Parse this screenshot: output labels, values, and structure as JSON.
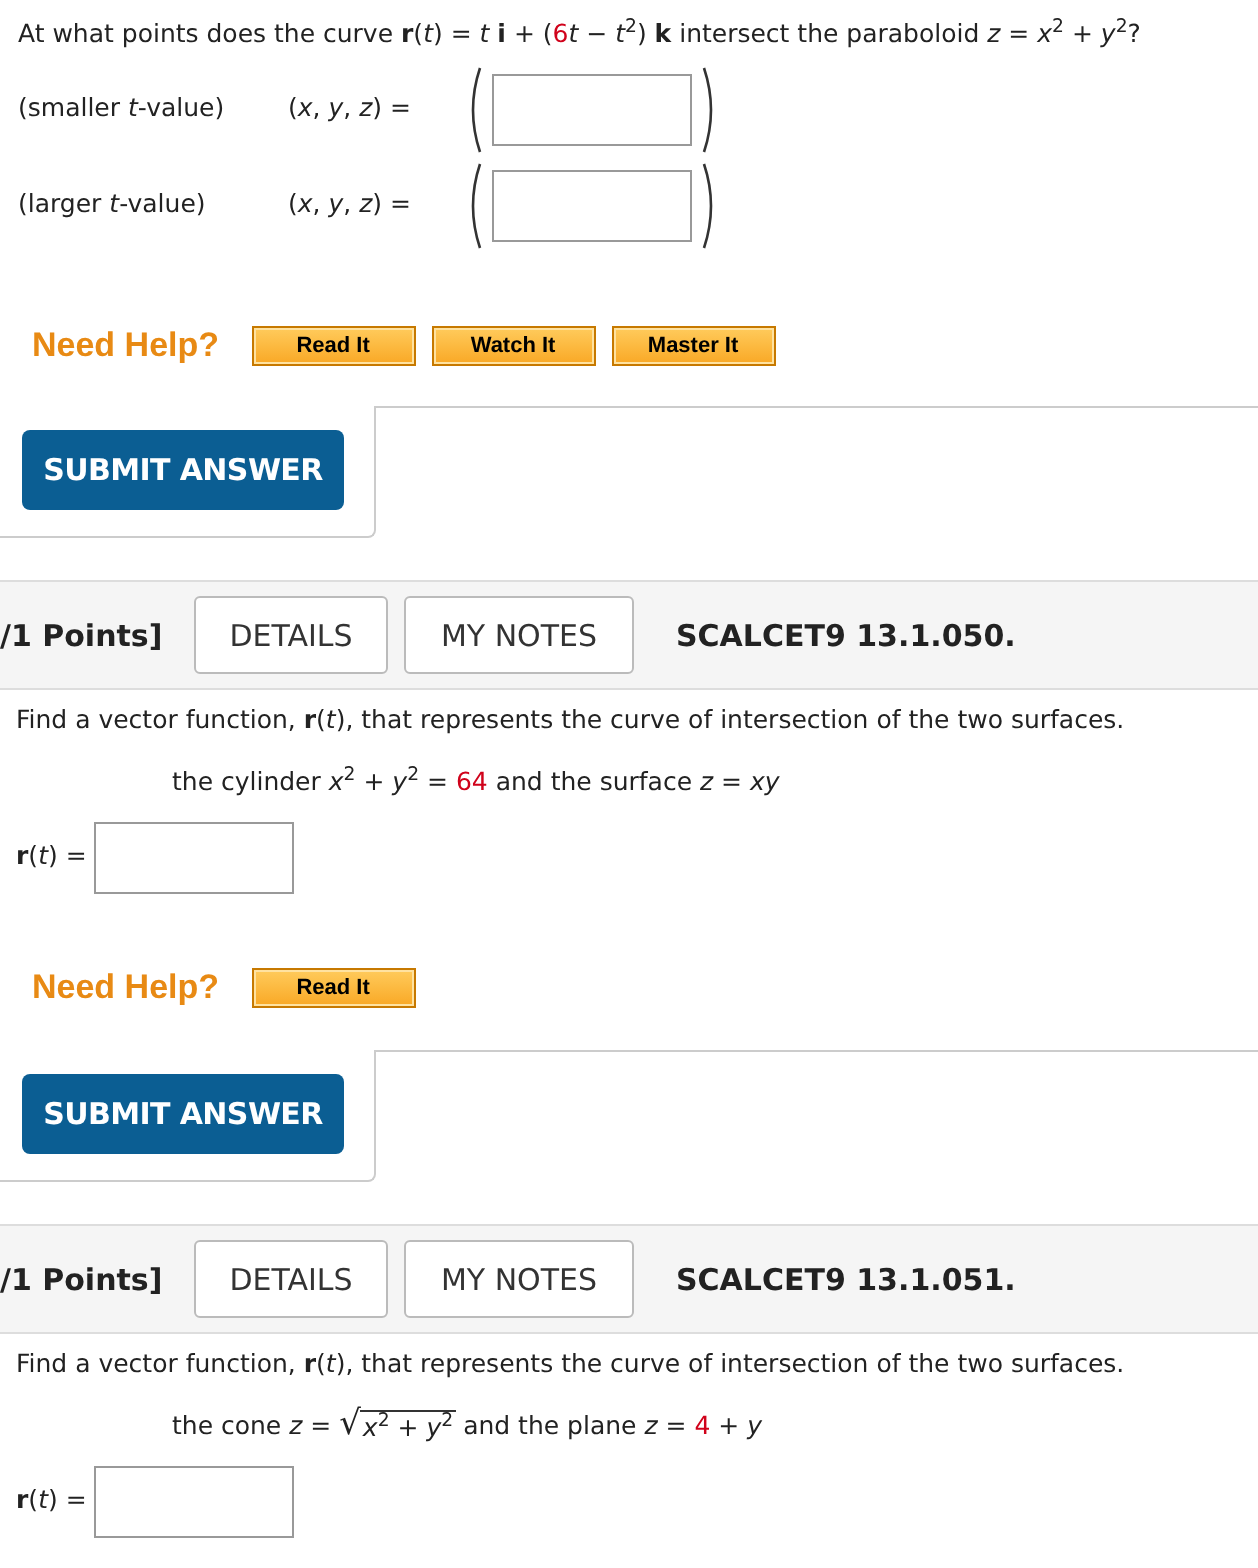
{
  "question": {
    "prompt": [
      {
        "kind": "text",
        "text": "At what points does the curve **r**(*t*) = *t* **i** + ("
      },
      {
        "kind": "given",
        "text": "6"
      },
      {
        "kind": "text",
        "text": "*t* − *t*$^{2}$) **k** intersect the paraboloid *z* = *x*$^{2}$ + *y*$^{2}$?"
      }
    ],
    "answers": [
      {
        "label": "(smaller *t*-value)",
        "coords": "(*x*, *y*, *z*) ="
      },
      {
        "label": "(larger *t*-value)",
        "coords": "(*x*, *y*, *z*) ="
      }
    ],
    "help": {
      "label": "Need Help?",
      "buttons": [
        "Read It",
        "Watch It",
        "Master It"
      ]
    },
    "submit": "SUBMIT ANSWER"
  },
  "problems": [
    {
      "points": "/1 Points]",
      "details": "DETAILS",
      "notes": "MY NOTES",
      "code": "SCALCET9 13.1.050.",
      "prompt": "Find a vector function, **r**(*t*), that represents the curve of intersection of the two surfaces.",
      "equation": [
        {
          "kind": "text",
          "text": "the cylinder *x*$^{2}$ + *y*$^{2}$ = "
        },
        {
          "kind": "given",
          "text": "64"
        },
        {
          "kind": "text",
          "text": " and the surface *z* = *xy*"
        }
      ],
      "answer_label": "**r**(*t*) =",
      "help": {
        "label": "Need Help?",
        "buttons": [
          "Read It"
        ]
      },
      "submit": "SUBMIT ANSWER"
    },
    {
      "points": "/1 Points]",
      "details": "DETAILS",
      "notes": "MY NOTES",
      "code": "SCALCET9 13.1.051.",
      "prompt": "Find a vector function, **r**(*t*), that represents the curve of intersection of the two surfaces.",
      "equation": [
        {
          "kind": "text",
          "text": "the cone *z* = "
        },
        {
          "kind": "sqrt",
          "sign": "√",
          "text": "*x*$^{2}$ + *y*$^{2}$"
        },
        {
          "kind": "text",
          "text": " and the plane *z* = "
        },
        {
          "kind": "given",
          "text": "4"
        },
        {
          "kind": "text",
          "text": " + *y*"
        }
      ],
      "answer_label": "**r**(*t*) ="
    }
  ]
}
